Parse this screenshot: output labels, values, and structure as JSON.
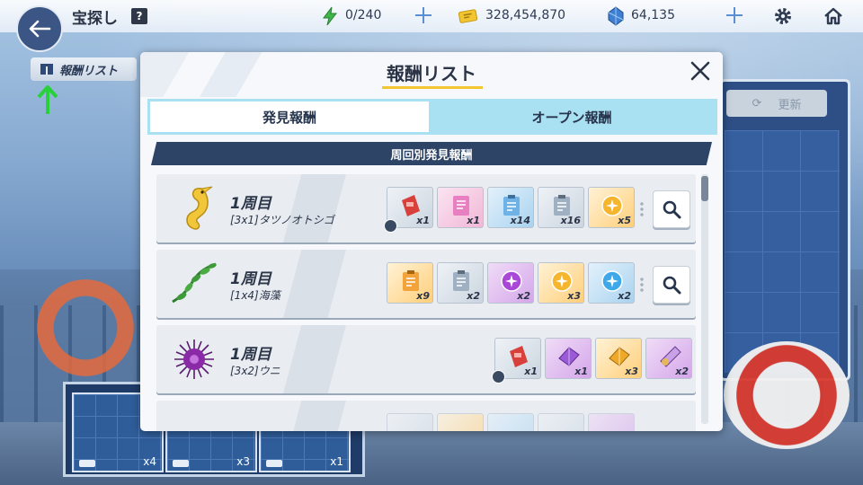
{
  "header": {
    "page_title": "宝探し",
    "help_label": "?",
    "stamina": "0/240",
    "gold": "328,454,870",
    "gems": "64,135"
  },
  "reward_list_button": {
    "label": "報酬リスト"
  },
  "modal": {
    "title": "報酬リスト",
    "tabs": [
      {
        "label": "発見報酬",
        "active": true
      },
      {
        "label": "オープン報酬",
        "active": false
      }
    ],
    "section": "周回別発見報酬",
    "rows": [
      {
        "lap": "1周目",
        "name": "[3x1]タツノオトシゴ",
        "icon": "seahorse-icon",
        "items": [
          {
            "icon": "red-ticket-icon",
            "qty": "x1",
            "bg": "grey",
            "timed": true
          },
          {
            "icon": "pink-document-icon",
            "qty": "x1",
            "bg": "pink"
          },
          {
            "icon": "blue-clipboard-icon",
            "qty": "x14",
            "bg": "blue"
          },
          {
            "icon": "grey-clipboard-icon",
            "qty": "x16",
            "bg": "grey"
          },
          {
            "icon": "gold-orb-icon",
            "qty": "x5",
            "bg": "orange"
          }
        ]
      },
      {
        "lap": "1周目",
        "name": "[1x4]海藻",
        "icon": "seaweed-icon",
        "items": [
          {
            "icon": "orange-clipboard-icon",
            "qty": "x9",
            "bg": "orange"
          },
          {
            "icon": "grey-clipboard-icon",
            "qty": "x2",
            "bg": "grey"
          },
          {
            "icon": "purple-orb-icon",
            "qty": "x2",
            "bg": "purple"
          },
          {
            "icon": "gold-orb-icon",
            "qty": "x3",
            "bg": "orange"
          },
          {
            "icon": "blue-orb-icon",
            "qty": "x2",
            "bg": "blue"
          }
        ]
      },
      {
        "lap": "1周目",
        "name": "[3x2]ウニ",
        "icon": "sea-urchin-icon",
        "items": [
          {
            "icon": "red-ticket-icon",
            "qty": "x1",
            "bg": "grey",
            "timed": true
          },
          {
            "icon": "purple-crystal-icon",
            "qty": "x1",
            "bg": "purple"
          },
          {
            "icon": "gold-crystal-icon",
            "qty": "x3",
            "bg": "orange"
          },
          {
            "icon": "purple-cone-icon",
            "qty": "x2",
            "bg": "purple"
          }
        ]
      }
    ]
  },
  "background": {
    "refresh_label": "更新",
    "bottom_counts": [
      "x4",
      "x3",
      "x1"
    ]
  }
}
